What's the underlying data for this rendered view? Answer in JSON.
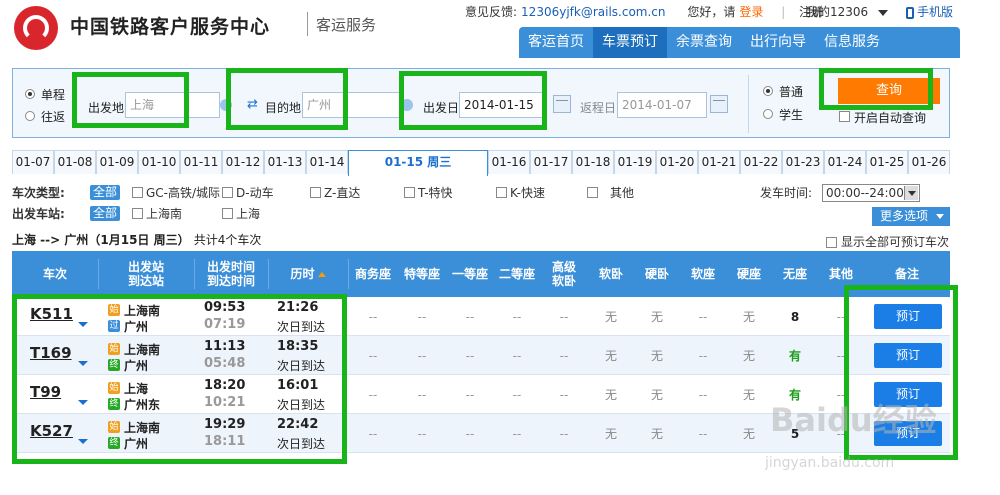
{
  "header": {
    "brand": "中国铁路客户服务中心",
    "brand_sub": "客运服务",
    "feedback_label": "意见反馈:",
    "feedback_email": "12306yjfk@rails.com.cn",
    "greeting": "您好，请",
    "login": "登录",
    "register": "注册",
    "my12306": "我的12306",
    "mobile": "手机版",
    "nav": [
      "客运首页",
      "车票预订",
      "余票查询",
      "出行向导",
      "信息服务"
    ]
  },
  "search": {
    "one_way": "单程",
    "round_trip": "往返",
    "from_label": "出发地",
    "from_value": "上海",
    "to_label": "目的地",
    "to_value": "广州",
    "depart_label": "出发日",
    "depart_value": "2014-01-15",
    "return_label": "返程日",
    "return_value": "2014-01-07",
    "normal": "普通",
    "student": "学生",
    "query_button": "查询",
    "auto_query": "开启自动查询"
  },
  "dates": [
    "01-07",
    "01-08",
    "01-09",
    "01-10",
    "01-11",
    "01-12",
    "01-13",
    "01-14",
    "01-15 周三",
    "01-16",
    "01-17",
    "01-18",
    "01-19",
    "01-20",
    "01-21",
    "01-22",
    "01-23",
    "01-24",
    "01-25",
    "01-26"
  ],
  "filters": {
    "train_type_label": "车次类型:",
    "all": "全部",
    "types": [
      "GC-高铁/城际",
      "D-动车",
      "Z-直达",
      "T-特快",
      "K-快速",
      "其他"
    ],
    "station_label": "出发车站:",
    "stations": [
      "上海南",
      "上海"
    ],
    "depart_time_label": "发车时间:",
    "depart_time_value": "00:00--24:00",
    "more_options": "更多选项"
  },
  "summary": {
    "route": "上海 --> 广州（1月15日 周三）",
    "count": "共计4个车次",
    "show_all": "显示全部可预订车次"
  },
  "table": {
    "headers": {
      "train": "车次",
      "stations": [
        "出发站",
        "到达站"
      ],
      "times": [
        "出发时间",
        "到达时间"
      ],
      "duration": "历时",
      "seats": [
        "商务座",
        "特等座",
        "一等座",
        "二等座",
        "高级软卧",
        "软卧",
        "硬卧",
        "软座",
        "硬座",
        "无座",
        "其他"
      ],
      "remark": "备注"
    },
    "rows": [
      {
        "train": "K511",
        "from_badge": "始",
        "from": "上海南",
        "to_badge": "过",
        "to": "广州",
        "depart": "09:53",
        "arrive": "07:19",
        "duration": "21:26",
        "next_day": "次日到达",
        "seats": [
          "--",
          "--",
          "--",
          "--",
          "--",
          "无",
          "无",
          "--",
          "无",
          "8",
          "--"
        ],
        "book": "预订"
      },
      {
        "train": "T169",
        "from_badge": "始",
        "from": "上海南",
        "to_badge": "终",
        "to": "广州",
        "depart": "11:13",
        "arrive": "05:48",
        "duration": "18:35",
        "next_day": "次日到达",
        "seats": [
          "--",
          "--",
          "--",
          "--",
          "--",
          "无",
          "无",
          "--",
          "无",
          "有",
          "--"
        ],
        "book": "预订"
      },
      {
        "train": "T99",
        "from_badge": "始",
        "from": "上海",
        "to_badge": "终",
        "to": "广州东",
        "depart": "18:20",
        "arrive": "10:21",
        "duration": "16:01",
        "next_day": "次日到达",
        "seats": [
          "--",
          "--",
          "--",
          "--",
          "--",
          "无",
          "无",
          "--",
          "无",
          "有",
          "--"
        ],
        "book": "预订"
      },
      {
        "train": "K527",
        "from_badge": "始",
        "from": "上海南",
        "to_badge": "终",
        "to": "广州",
        "depart": "19:29",
        "arrive": "18:11",
        "duration": "22:42",
        "next_day": "次日到达",
        "seats": [
          "--",
          "--",
          "--",
          "--",
          "--",
          "无",
          "无",
          "--",
          "无",
          "5",
          "--"
        ],
        "book": "预订"
      }
    ]
  },
  "watermark": "Baidu经验",
  "watermark_url": "jingyan.baidu.com",
  "colors": {
    "accent": "#3a8fd8",
    "query_button": "#ff7a00",
    "highlight_box": "#19b419",
    "book_button": "#1a7ee6",
    "logo": "#d9262c"
  }
}
